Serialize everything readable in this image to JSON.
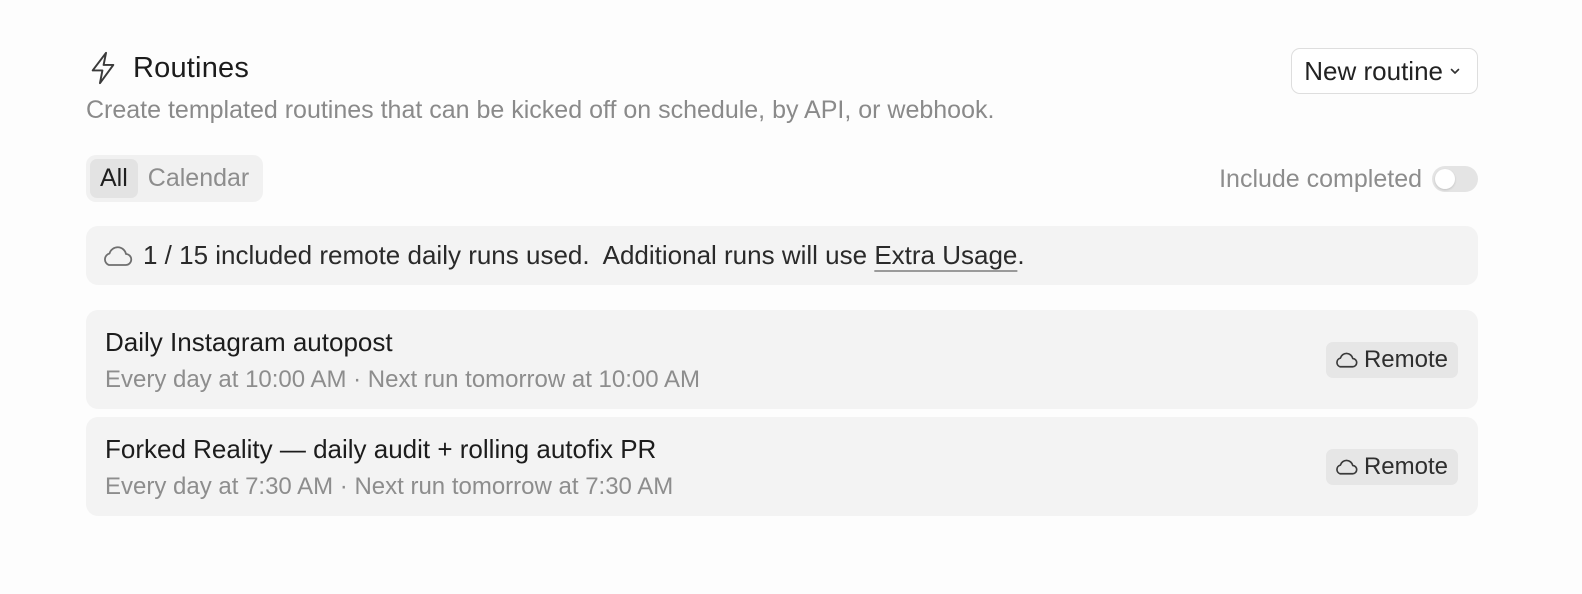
{
  "header": {
    "title": "Routines",
    "title_icon": "lightning-bolt-icon",
    "new_routine_label": "New routine",
    "subtitle": "Create templated routines that can be kicked off on schedule, by API, or webhook."
  },
  "tabs": [
    {
      "label": "All",
      "active": true
    },
    {
      "label": "Calendar",
      "active": false
    }
  ],
  "filters": {
    "include_completed_label": "Include completed",
    "include_completed": false
  },
  "usage": {
    "icon": "cloud-icon",
    "text": "1 / 15 included remote daily runs used.  Additional runs will use ",
    "link_label": "Extra Usage",
    "suffix": "."
  },
  "routines": [
    {
      "name": "Daily Instagram autopost",
      "schedule": "Every day at 10:00 AM · Next run tomorrow at 10:00 AM",
      "badge": "Remote"
    },
    {
      "name": "Forked Reality — daily audit + rolling autofix PR",
      "schedule": "Every day at 7:30 AM · Next run tomorrow at 7:30 AM",
      "badge": "Remote"
    }
  ],
  "colors": {
    "background": "#fdfdfd",
    "card": "#f3f3f3",
    "badge": "#e6e6e6",
    "muted_text": "#8d8d8d"
  }
}
